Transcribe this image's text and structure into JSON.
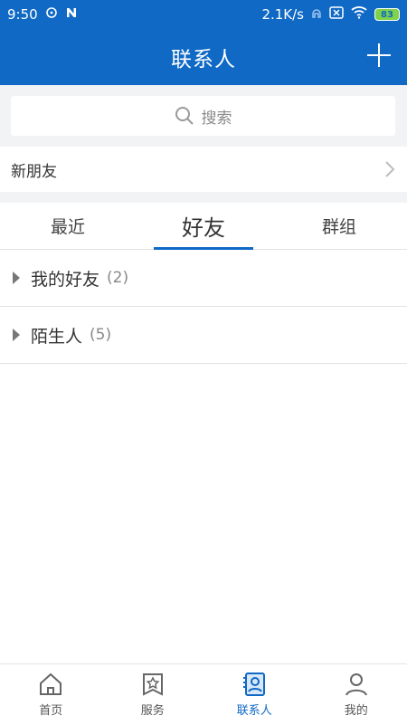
{
  "status": {
    "time": "9:50",
    "speed": "2.1K/s",
    "battery": "83",
    "colors": {
      "bar": "#0f69c5",
      "battery": "#7fd24a"
    }
  },
  "header": {
    "title": "联系人",
    "add_icon": "plus-icon"
  },
  "search": {
    "placeholder": "搜索",
    "icon": "search-icon"
  },
  "new_friends": {
    "label": "新朋友",
    "icon": "chevron-right-icon"
  },
  "tabs": [
    {
      "label": "最近",
      "active": false
    },
    {
      "label": "好友",
      "active": true
    },
    {
      "label": "群组",
      "active": false
    }
  ],
  "groups": [
    {
      "name": "我的好友",
      "count": "(2)"
    },
    {
      "name": "陌生人",
      "count": "(5)"
    }
  ],
  "bottom_nav": [
    {
      "label": "首页",
      "icon": "home-icon",
      "active": false
    },
    {
      "label": "服务",
      "icon": "service-icon",
      "active": false
    },
    {
      "label": "联系人",
      "icon": "contacts-icon",
      "active": true
    },
    {
      "label": "我的",
      "icon": "profile-icon",
      "active": false
    }
  ]
}
